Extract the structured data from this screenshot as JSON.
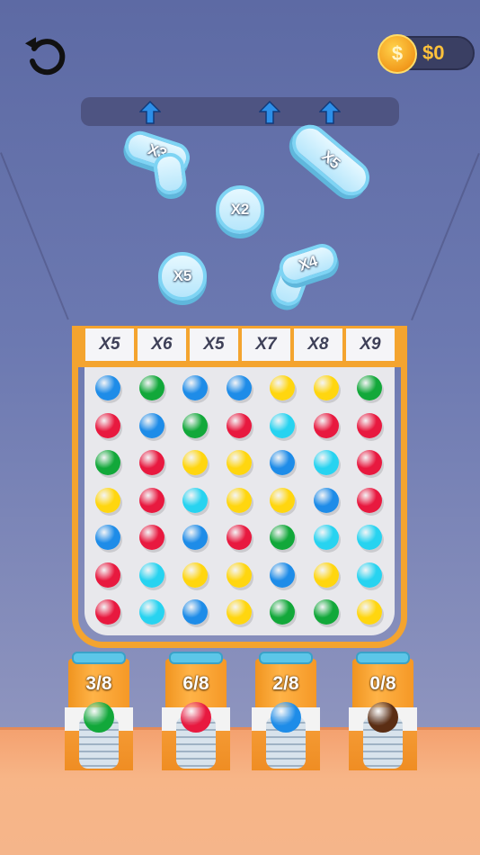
{
  "hud": {
    "restart_icon": "restart-icon",
    "coins": "$0",
    "coin_symbol": "$",
    "coin_icon": "dollar-coin-icon"
  },
  "pieces": [
    {
      "label": "X3"
    },
    {
      "label": "X5"
    },
    {
      "label": "X2"
    },
    {
      "label": "X5"
    },
    {
      "label": "X4"
    }
  ],
  "multipliers": [
    "X5",
    "X6",
    "X5",
    "X7",
    "X8",
    "X9"
  ],
  "colors": {
    "blue": "#1e8ce8",
    "green": "#12a83a",
    "red": "#e8193f",
    "yellow": "#ffd60f",
    "cyan": "#27d3f0",
    "brown": "#5b2e14"
  },
  "grid": [
    [
      "blue",
      "green",
      "blue",
      "blue",
      "yellow",
      "yellow",
      "green"
    ],
    [
      "red",
      "blue",
      "green",
      "red",
      "cyan",
      "red",
      "red"
    ],
    [
      "green",
      "red",
      "yellow",
      "yellow",
      "blue",
      "cyan",
      "red"
    ],
    [
      "yellow",
      "red",
      "cyan",
      "yellow",
      "yellow",
      "blue",
      "red"
    ],
    [
      "blue",
      "red",
      "blue",
      "red",
      "green",
      "cyan",
      "cyan"
    ],
    [
      "red",
      "cyan",
      "yellow",
      "yellow",
      "blue",
      "yellow",
      "cyan"
    ],
    [
      "red",
      "cyan",
      "blue",
      "yellow",
      "green",
      "green",
      "yellow"
    ]
  ],
  "tubes": [
    {
      "count": "3/8",
      "color": "green"
    },
    {
      "count": "6/8",
      "color": "red"
    },
    {
      "count": "2/8",
      "color": "blue"
    },
    {
      "count": "0/8",
      "color": "brown"
    }
  ]
}
